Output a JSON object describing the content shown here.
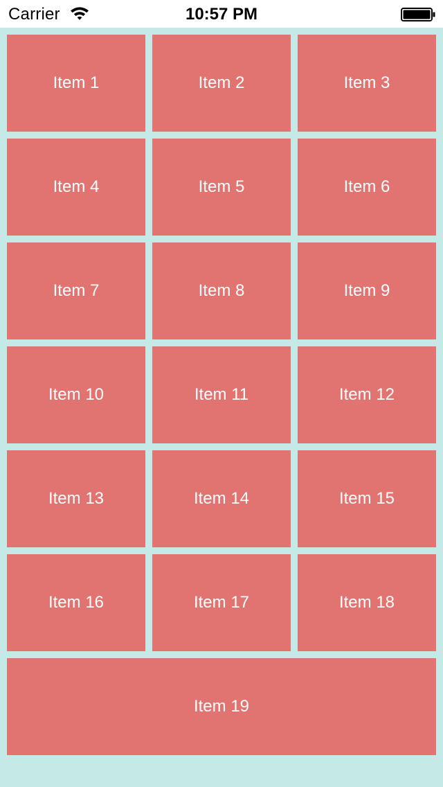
{
  "status_bar": {
    "carrier": "Carrier",
    "time": "10:57 PM",
    "wifi_icon": "wifi-icon",
    "battery_icon": "battery-icon"
  },
  "colors": {
    "background": "#c4e9e6",
    "tile": "#e17471",
    "tile_text": "#ffffff"
  },
  "items": [
    {
      "label": "Item 1"
    },
    {
      "label": "Item 2"
    },
    {
      "label": "Item 3"
    },
    {
      "label": "Item 4"
    },
    {
      "label": "Item 5"
    },
    {
      "label": "Item 6"
    },
    {
      "label": "Item 7"
    },
    {
      "label": "Item 8"
    },
    {
      "label": "Item 9"
    },
    {
      "label": "Item 10"
    },
    {
      "label": "Item 11"
    },
    {
      "label": "Item 12"
    },
    {
      "label": "Item 13"
    },
    {
      "label": "Item 14"
    },
    {
      "label": "Item 15"
    },
    {
      "label": "Item 16"
    },
    {
      "label": "Item 17"
    },
    {
      "label": "Item 18"
    },
    {
      "label": "Item 19"
    }
  ]
}
